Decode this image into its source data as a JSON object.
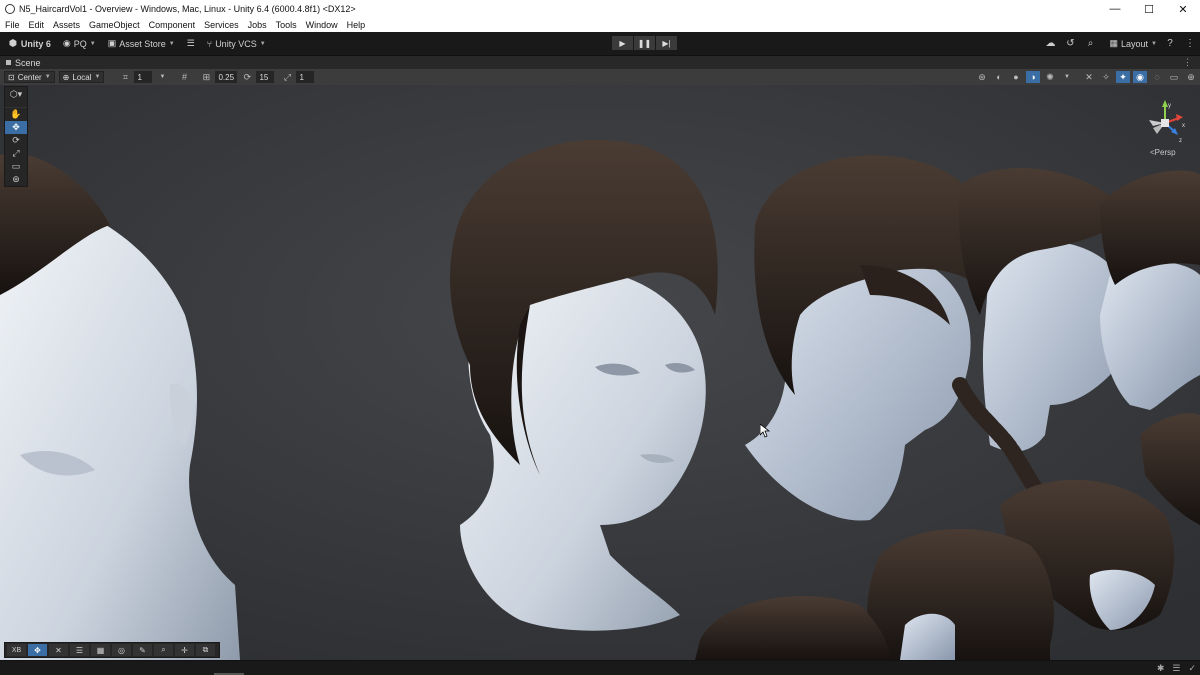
{
  "window": {
    "title": "N5_HaircardVol1 - Overview - Windows, Mac, Linux - Unity 6.4 (6000.4.8f1) <DX12>",
    "controls": {
      "minimize": "—",
      "maximize": "☐",
      "close": "✕"
    }
  },
  "menu": [
    "File",
    "Edit",
    "Assets",
    "GameObject",
    "Component",
    "Services",
    "Jobs",
    "Tools",
    "Window",
    "Help"
  ],
  "toolbar": {
    "unity_label": "Unity 6",
    "account_label": "PQ",
    "asset_store_label": "Asset Store",
    "vcs_label": "Unity VCS",
    "layout_label": "Layout"
  },
  "tab": {
    "scene_label": "Scene"
  },
  "scenebar": {
    "pivot_label": "Center",
    "space_label": "Local",
    "grid_value": "1",
    "snap_value": "0.25",
    "rotate_snap_value": "15",
    "scale_snap_value": "1"
  },
  "viewport": {
    "camera_mode_label": "Persp",
    "gizmo_axes": {
      "y": "y",
      "x": "x",
      "z": "z"
    }
  },
  "overlay": {
    "first_label": "XB"
  },
  "colors": {
    "accent": "#3a6ea5",
    "background": "#393a3d",
    "gizmo_y": "#8fd14f",
    "gizmo_x": "#e0443a",
    "gizmo_z": "#3b7fe0"
  }
}
